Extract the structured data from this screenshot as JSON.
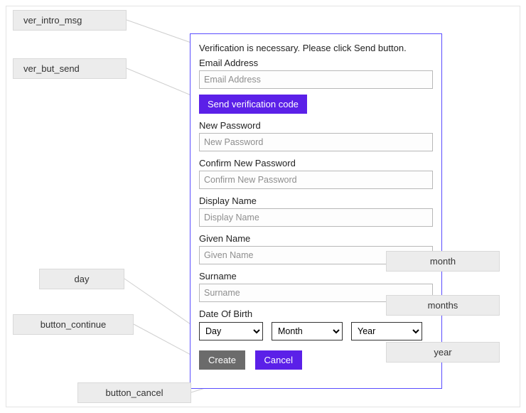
{
  "tags": {
    "ver_intro_msg": "ver_intro_msg",
    "ver_but_send": "ver_but_send",
    "day": "day",
    "button_continue": "button_continue",
    "button_cancel": "button_cancel",
    "month": "month",
    "months": "months",
    "year": "year"
  },
  "form": {
    "intro": "Verification is necessary. Please click Send button.",
    "email_label": "Email Address",
    "email_placeholder": "Email Address",
    "send_label": "Send verification code",
    "newpw_label": "New Password",
    "newpw_placeholder": "New Password",
    "confpw_label": "Confirm New Password",
    "confpw_placeholder": "Confirm New Password",
    "display_label": "Display Name",
    "display_placeholder": "Display Name",
    "given_label": "Given Name",
    "given_placeholder": "Given Name",
    "surname_label": "Surname",
    "surname_placeholder": "Surname",
    "dob_label": "Date Of Birth",
    "day_option": "Day",
    "month_option": "Month",
    "year_option": "Year",
    "create_label": "Create",
    "cancel_label": "Cancel"
  }
}
